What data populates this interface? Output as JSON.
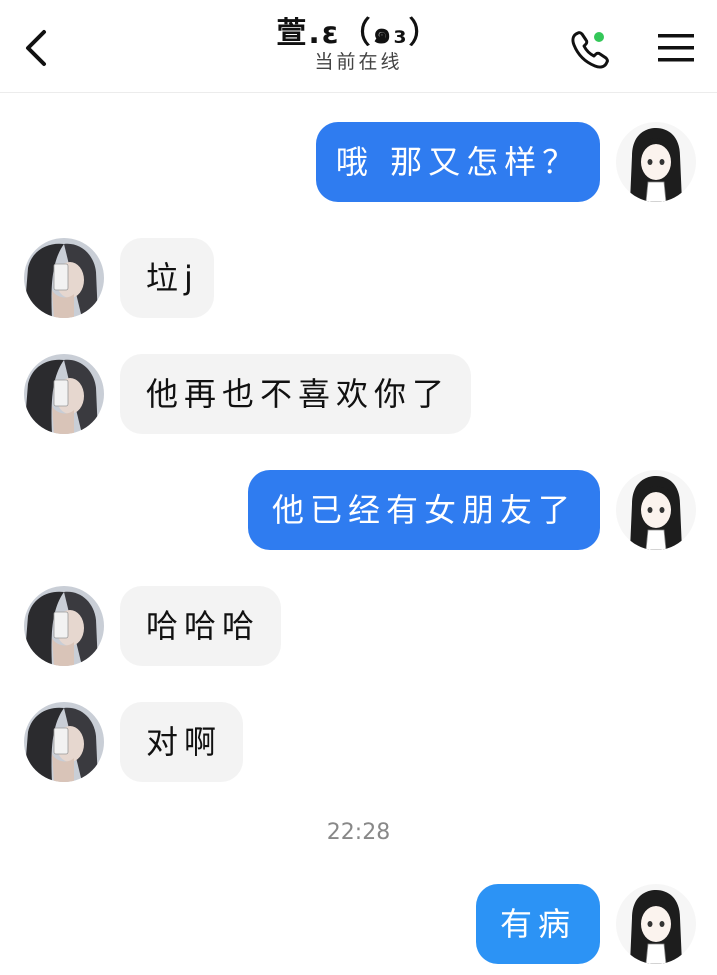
{
  "header": {
    "title": "萱.ɛ（๑₃）",
    "status": "当前在线",
    "online_color": "#34c759"
  },
  "messages": [
    {
      "side": "right",
      "text": "哦 那又怎样？"
    },
    {
      "side": "left",
      "text": "垃j"
    },
    {
      "side": "left",
      "text": "他再也不喜欢你了"
    },
    {
      "side": "right",
      "text": "他已经有女朋友了"
    },
    {
      "side": "left",
      "text": "哈哈哈"
    },
    {
      "side": "left",
      "text": "对啊"
    },
    {
      "side": "right",
      "text": "有病"
    }
  ],
  "timestamp": "22:28",
  "colors": {
    "bubble_right": "#2f7cf0",
    "bubble_left": "#f3f3f3"
  }
}
